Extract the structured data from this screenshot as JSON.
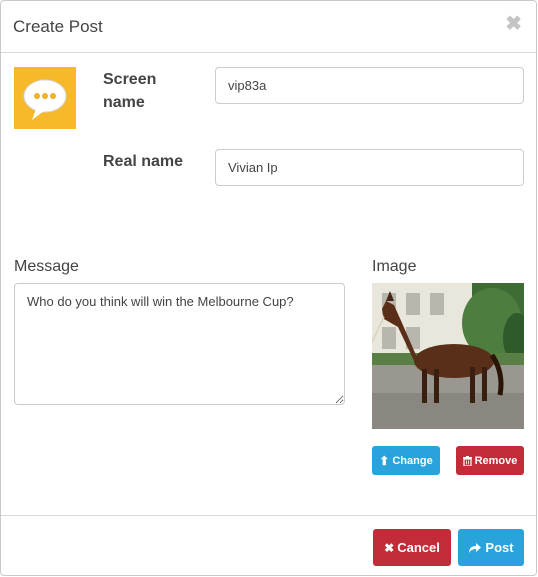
{
  "dialog": {
    "title": "Create Post",
    "close_glyph": "✖"
  },
  "avatar": {
    "icon": "chat-bubble-icon"
  },
  "form": {
    "screen_name_label": "Screen name",
    "screen_name_value": "vip83a",
    "real_name_label": "Real name",
    "real_name_value": "Vivian Ip"
  },
  "message": {
    "label": "Message",
    "value": "Who do you think will win the Melbourne Cup?"
  },
  "image": {
    "label": "Image",
    "change_label": "Change",
    "remove_label": "Remove",
    "change_icon": "upload-icon",
    "remove_icon": "trash-icon"
  },
  "footer": {
    "cancel_label": "Cancel",
    "post_label": "Post",
    "cancel_icon": "x-icon",
    "post_icon": "share-arrow-icon"
  },
  "colors": {
    "primary": "#2aa3dc",
    "danger": "#c22c38",
    "avatar_bg": "#f6b92a"
  }
}
